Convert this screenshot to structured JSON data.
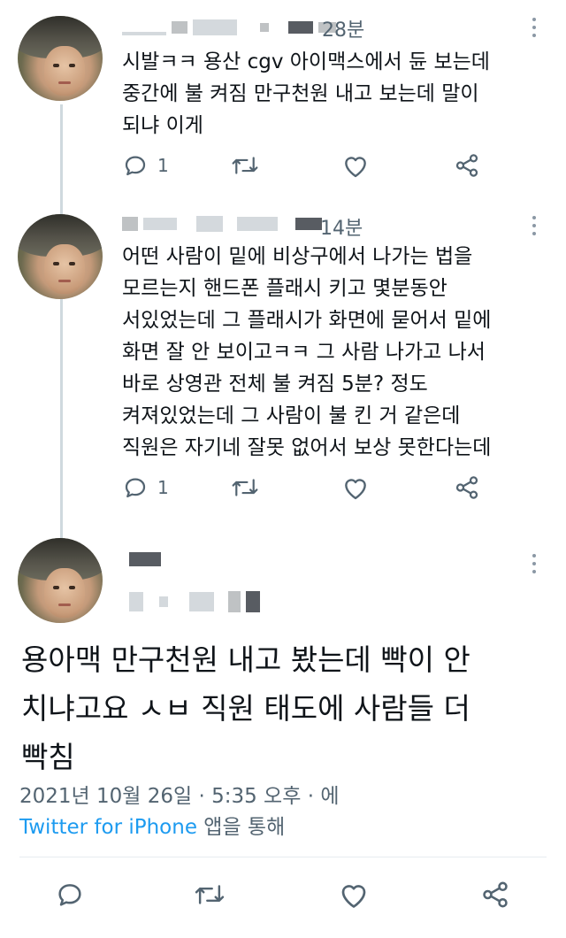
{
  "tweets": [
    {
      "time": "28분",
      "lines": [
        "시발ㅋㅋ 용산 cgv 아이맥스에서 듄 보는데",
        "중간에 불 켜짐 만구천원 내고 보는데 말이",
        "되냐 이게"
      ],
      "reply_count": "1"
    },
    {
      "time": "14분",
      "lines": [
        "어떤 사람이 밑에 비상구에서 나가는 법을",
        "모르는지 핸드폰 플래시 키고 몇분동안",
        "서있었는데 그 플래시가 화면에 묻어서 밑에",
        "화면 잘 안 보이고ㅋㅋ 그 사람 나가고 나서",
        "바로 상영관 전체 불 켜짐 5분? 정도",
        "켜져있었는데 그 사람이 불 킨 거 같은데",
        "직원은 자기네 잘못 없어서 보상 못한다는데"
      ],
      "reply_count": "1"
    }
  ],
  "main_tweet": {
    "lines": [
      "용아맥 만구천원 내고 봤는데 빡이 안",
      "치냐고요 ㅅㅂ 직원 태도에 사람들 더",
      "빡침"
    ],
    "meta": "2021년 10월 26일 · 5:35 오후 · 에",
    "source_app": "Twitter for iPhone",
    "source_suffix": " 앱을 통해"
  },
  "icons": {
    "reply": "reply-icon",
    "retweet": "retweet-icon",
    "like": "like-icon",
    "share": "share-icon",
    "more": "more-icon"
  },
  "colors": {
    "text": "#0f1419",
    "secondary": "#536471",
    "link": "#1d9bf0",
    "thread_line": "#cfd9de"
  }
}
